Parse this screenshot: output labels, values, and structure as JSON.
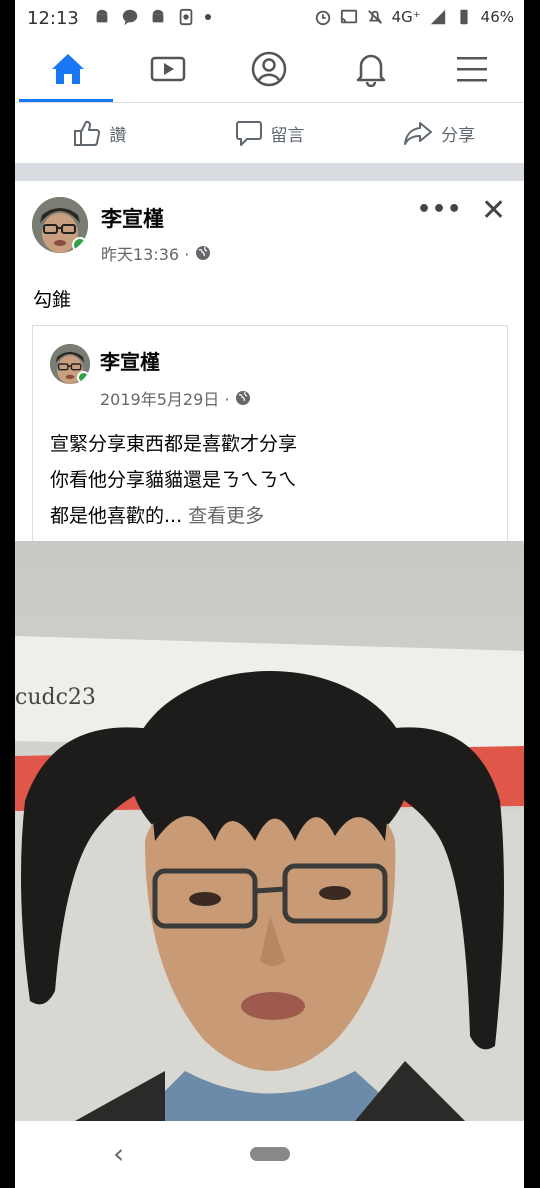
{
  "status_bar": {
    "time": "12:13",
    "network": "4G⁺",
    "battery": "46%"
  },
  "nav": {
    "tabs": [
      "home-icon",
      "video-icon",
      "profile-icon",
      "bell-icon",
      "menu-icon"
    ],
    "active_tab": "home",
    "accent": "#1877f2"
  },
  "actions": {
    "like": "讚",
    "comment": "留言",
    "share": "分享"
  },
  "post": {
    "author": "李宣槿",
    "time": "昨天13:36 ·",
    "text": "勾錐",
    "shared": {
      "author": "李宣槿",
      "date": "2019年5月29日 ·",
      "lines": [
        "宣緊分享東西都是喜歡才分享",
        "你看他分享貓貓還是ㄋㄟㄋㄟ",
        "都是他喜歡的..."
      ],
      "see_more": "查看更多"
    }
  },
  "photo": {
    "watermark": "cudc23"
  }
}
